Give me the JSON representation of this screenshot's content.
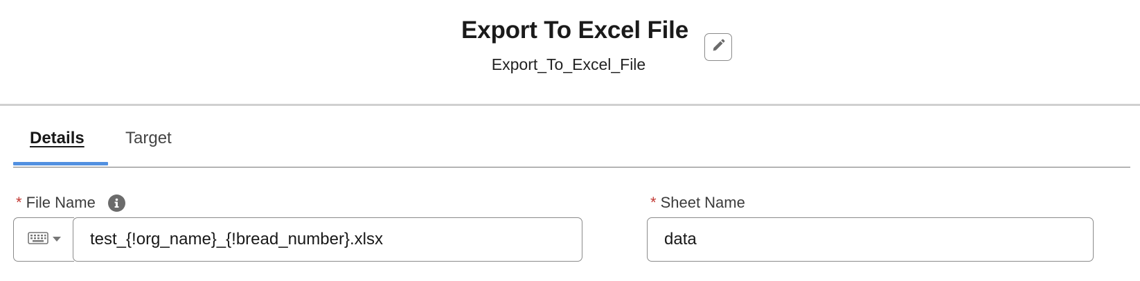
{
  "header": {
    "title": "Export To Excel File",
    "api_name": "Export_To_Excel_File",
    "edit_icon": "pencil-icon"
  },
  "tabs": [
    {
      "label": "Details",
      "active": true
    },
    {
      "label": "Target",
      "active": false
    }
  ],
  "fields": {
    "file_name": {
      "label": "File Name",
      "required_mark": "*",
      "value": "test_{!org_name}_{!bread_number}.xlsx",
      "info_icon": "info-icon",
      "mode_icon": "keyboard-icon"
    },
    "sheet_name": {
      "label": "Sheet Name",
      "required_mark": "*",
      "value": "data"
    }
  },
  "colors": {
    "accent": "#5290e0",
    "required": "#c23934",
    "border": "#8a8a8a"
  }
}
